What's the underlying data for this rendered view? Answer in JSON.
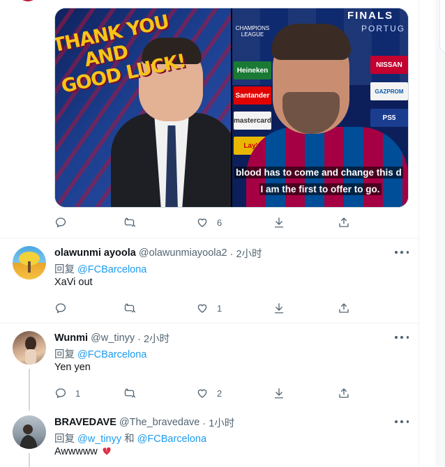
{
  "main_tweet": {
    "media_left": {
      "banner_lines": [
        "THANK YOU",
        "AND",
        "GOOD LUCK!"
      ]
    },
    "media_right": {
      "finals_text": "FINALS",
      "finals_sub": "PORTUG",
      "ucl_label": "CHAMPIONS LEAGUE",
      "sponsors": [
        "Heineken",
        "Santander",
        "mastercard",
        "Lay's",
        "NISSAN",
        "GAZPROM",
        "PS5"
      ],
      "caption_line1": "blood has to come and change this d",
      "caption_line2": "I am the first to offer to go."
    },
    "actions": {
      "reply_count": "",
      "retweet_count": "",
      "like_count": "6"
    }
  },
  "replies": [
    {
      "name": "olawunmi ayoola",
      "handle": "@olawunmiayoola2",
      "time": "· 2小时",
      "reply_prefix": "回复",
      "reply_to": "@FCBarcelona",
      "text": "XaVi out",
      "reply_count": "",
      "retweet_count": "",
      "like_count": "1"
    },
    {
      "name": "Wunmi",
      "handle": "@w_tinyy",
      "time": "· 2小时",
      "reply_prefix": "回复",
      "reply_to": "@FCBarcelona",
      "text": "Yen yen",
      "reply_count": "1",
      "retweet_count": "",
      "like_count": "2"
    },
    {
      "name": "BRAVEDAVE",
      "handle": "@The_bravedave",
      "time": "· 1小时",
      "reply_prefix": "回复",
      "reply_to": "@w_tinyy",
      "reply_conj": "和",
      "reply_to_2": "@FCBarcelona",
      "text": "Awwwww"
    }
  ],
  "colors": {
    "link": "#1d9bf0",
    "secondary_text": "#536471",
    "primary_text": "#0f1419",
    "divider": "#eff3f4"
  },
  "icons": [
    "reply-icon",
    "retweet-icon",
    "like-icon",
    "download-icon",
    "share-icon",
    "more-icon",
    "broken-heart-icon"
  ]
}
